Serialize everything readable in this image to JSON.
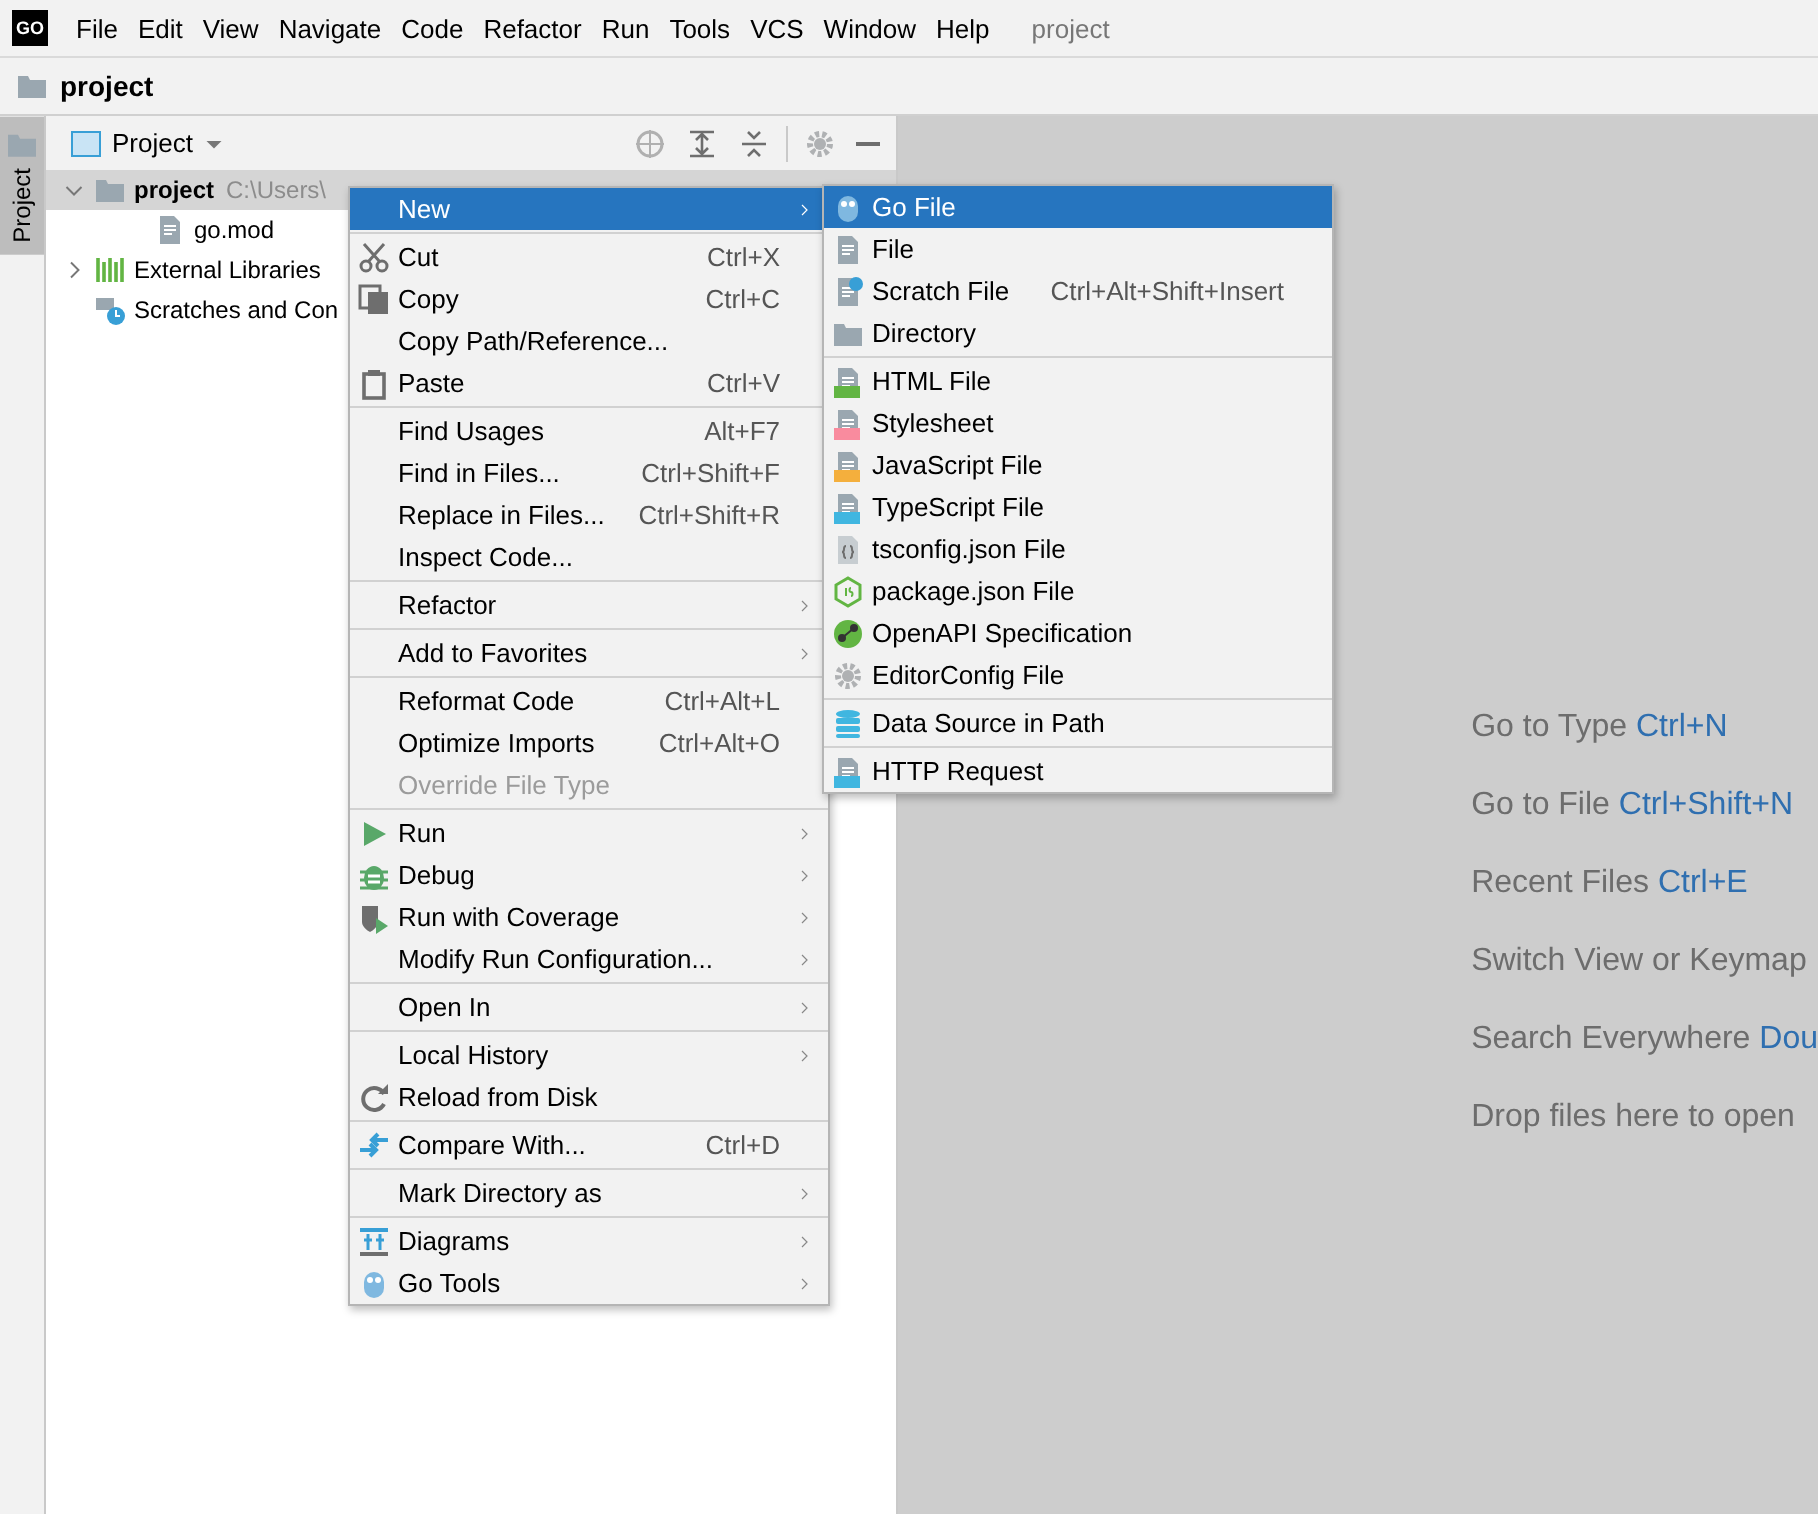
{
  "menubar": {
    "logo": "GO",
    "items": [
      "File",
      "Edit",
      "View",
      "Navigate",
      "Code",
      "Refactor",
      "Run",
      "Tools",
      "VCS",
      "Window",
      "Help"
    ],
    "title": "project"
  },
  "navbar": {
    "crumb": "project"
  },
  "tool_strip": {
    "tab": {
      "label": "Project",
      "selected": true
    }
  },
  "project_panel": {
    "view": "Project",
    "tree": [
      {
        "kind": "folder",
        "label": "project",
        "path": "C:\\Users\\",
        "expanded": true,
        "selected": true,
        "children": [
          {
            "kind": "file",
            "label": "go.mod"
          }
        ]
      },
      {
        "kind": "library",
        "label": "External Libraries",
        "expanded": false,
        "selected": false
      },
      {
        "kind": "scratches",
        "label": "Scratches and Con",
        "selected": false
      }
    ]
  },
  "editor_hints": [
    {
      "text": "Go to Type ",
      "shortcut": "Ctrl+N"
    },
    {
      "text": "Go to File ",
      "shortcut": "Ctrl+Shift+N"
    },
    {
      "text": "Recent Files ",
      "shortcut": "Ctrl+E"
    },
    {
      "text": "Switch View or Keymap"
    },
    {
      "text": "Search Everywhere ",
      "shortcut": "Dou"
    },
    {
      "text": "Drop files here to open"
    }
  ],
  "context_menu": {
    "groups": [
      [
        {
          "label": "New",
          "submenu": true,
          "selected": true,
          "disabled": false
        }
      ],
      [
        {
          "label": "Cut",
          "shortcut": "Ctrl+X",
          "selected": false,
          "disabled": false
        },
        {
          "label": "Copy",
          "shortcut": "Ctrl+C",
          "selected": false,
          "disabled": false
        },
        {
          "label": "Copy Path/Reference...",
          "selected": false,
          "disabled": false
        },
        {
          "label": "Paste",
          "shortcut": "Ctrl+V",
          "selected": false,
          "disabled": false
        }
      ],
      [
        {
          "label": "Find Usages",
          "shortcut": "Alt+F7",
          "selected": false,
          "disabled": false
        },
        {
          "label": "Find in Files...",
          "shortcut": "Ctrl+Shift+F",
          "selected": false,
          "disabled": false
        },
        {
          "label": "Replace in Files...",
          "shortcut": "Ctrl+Shift+R",
          "selected": false,
          "disabled": false
        },
        {
          "label": "Inspect Code...",
          "selected": false,
          "disabled": false
        }
      ],
      [
        {
          "label": "Refactor",
          "submenu": true,
          "selected": false,
          "disabled": false
        }
      ],
      [
        {
          "label": "Add to Favorites",
          "submenu": true,
          "selected": false,
          "disabled": false
        }
      ],
      [
        {
          "label": "Reformat Code",
          "shortcut": "Ctrl+Alt+L",
          "selected": false,
          "disabled": false
        },
        {
          "label": "Optimize Imports",
          "shortcut": "Ctrl+Alt+O",
          "selected": false,
          "disabled": false
        },
        {
          "label": "Override File Type",
          "selected": false,
          "disabled": true
        }
      ],
      [
        {
          "label": "Run",
          "submenu": true,
          "selected": false,
          "disabled": false
        },
        {
          "label": "Debug",
          "submenu": true,
          "selected": false,
          "disabled": false
        },
        {
          "label": "Run with Coverage",
          "submenu": true,
          "selected": false,
          "disabled": false
        },
        {
          "label": "Modify Run Configuration...",
          "submenu": true,
          "selected": false,
          "disabled": false
        }
      ],
      [
        {
          "label": "Open In",
          "submenu": true,
          "selected": false,
          "disabled": false
        }
      ],
      [
        {
          "label": "Local History",
          "submenu": true,
          "selected": false,
          "disabled": false
        },
        {
          "label": "Reload from Disk",
          "selected": false,
          "disabled": false
        }
      ],
      [
        {
          "label": "Compare With...",
          "shortcut": "Ctrl+D",
          "selected": false,
          "disabled": false
        }
      ],
      [
        {
          "label": "Mark Directory as",
          "submenu": true,
          "selected": false,
          "disabled": false
        }
      ],
      [
        {
          "label": "Diagrams",
          "submenu": true,
          "selected": false,
          "disabled": false
        },
        {
          "label": "Go Tools",
          "submenu": true,
          "selected": false,
          "disabled": false
        }
      ]
    ]
  },
  "new_submenu": {
    "groups": [
      [
        {
          "label": "Go File",
          "selected": true
        },
        {
          "label": "File",
          "selected": false
        },
        {
          "label": "Scratch File",
          "shortcut": "Ctrl+Alt+Shift+Insert",
          "selected": false
        },
        {
          "label": "Directory",
          "selected": false
        }
      ],
      [
        {
          "label": "HTML File",
          "selected": false
        },
        {
          "label": "Stylesheet",
          "selected": false
        },
        {
          "label": "JavaScript File",
          "selected": false
        },
        {
          "label": "TypeScript File",
          "selected": false
        },
        {
          "label": "tsconfig.json File",
          "selected": false
        },
        {
          "label": "package.json File",
          "selected": false
        },
        {
          "label": "OpenAPI Specification",
          "selected": false
        },
        {
          "label": "EditorConfig File",
          "selected": false
        }
      ],
      [
        {
          "label": "Data Source in Path",
          "selected": false
        }
      ],
      [
        {
          "label": "HTTP Request",
          "selected": false
        }
      ]
    ]
  }
}
